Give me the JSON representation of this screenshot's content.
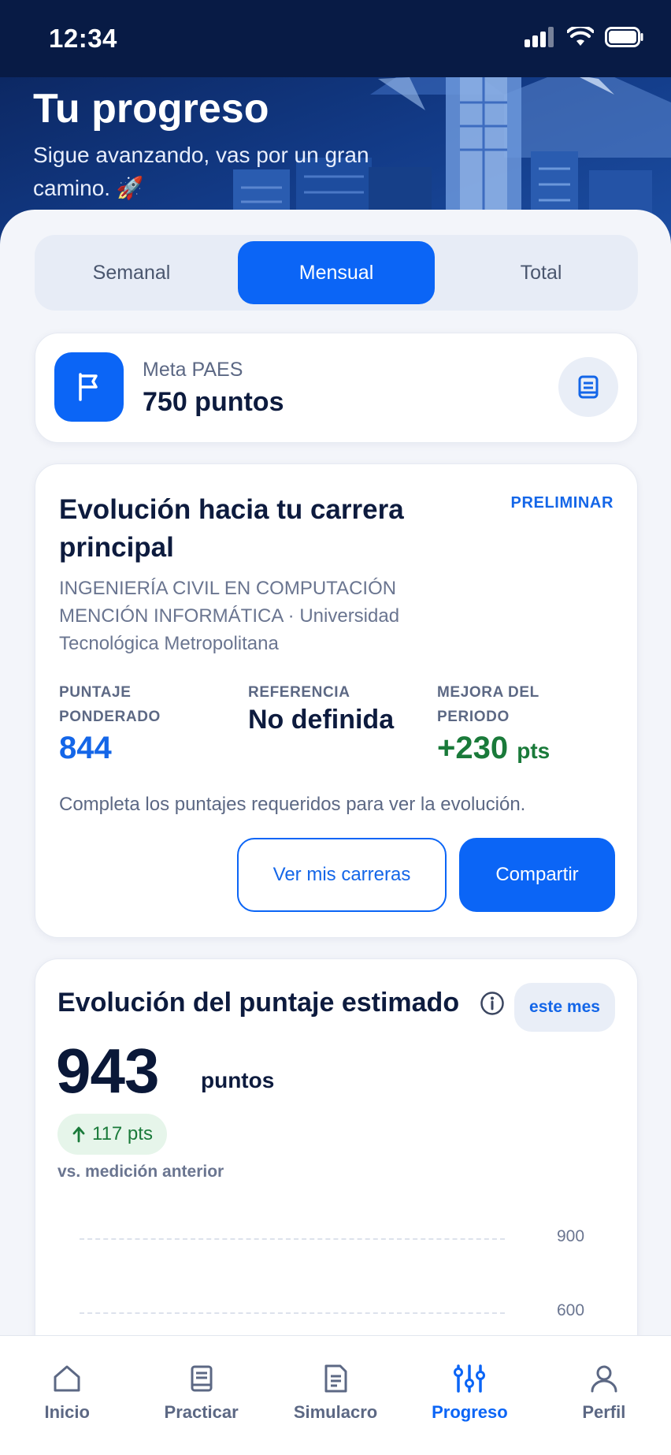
{
  "status_bar": {
    "time": "12:34"
  },
  "header": {
    "title": "Tu progreso",
    "subtitle": "Sigue avanzando, vas por un gran camino. 🚀"
  },
  "tabs": [
    {
      "label": "Semanal",
      "active": false
    },
    {
      "label": "Mensual",
      "active": true
    },
    {
      "label": "Total",
      "active": false
    }
  ],
  "goal": {
    "label": "Meta PAES",
    "value": "750 puntos"
  },
  "career": {
    "title": "Evolución hacia tu carrera principal",
    "badge": "PRELIMINAR",
    "description": "INGENIERÍA CIVIL EN COMPUTACIÓN MENCIÓN INFORMÁTICA · Universidad Tecnológica Metropolitana",
    "stats": {
      "weighted_label": "PUNTAJE PONDERADO",
      "weighted_value": "844",
      "reference_label": "REFERENCIA",
      "reference_value": "No definida",
      "improvement_label": "MEJORA DEL PERIODO",
      "improvement_value": "+230",
      "improvement_unit": "pts"
    },
    "note": "Completa los puntajes requeridos para ver la evolución.",
    "buttons": {
      "careers": "Ver mis carreras",
      "share": "Compartir"
    }
  },
  "estimate": {
    "title": "Evolución del puntaje estimado",
    "period": "este mes",
    "score": "943",
    "unit": "puntos",
    "delta": "117 pts",
    "delta_caption": "vs. medición anterior",
    "axis_ticks": [
      "900",
      "600"
    ]
  },
  "nav": [
    {
      "label": "Inicio",
      "icon": "home-icon",
      "active": false
    },
    {
      "label": "Practicar",
      "icon": "book-icon",
      "active": false
    },
    {
      "label": "Simulacro",
      "icon": "document-icon",
      "active": false
    },
    {
      "label": "Progreso",
      "icon": "sliders-icon",
      "active": true
    },
    {
      "label": "Perfil",
      "icon": "user-icon",
      "active": false
    }
  ],
  "colors": {
    "primary": "#0b65f6",
    "header_bg": "#0a2156",
    "success": "#1a7a3a"
  }
}
